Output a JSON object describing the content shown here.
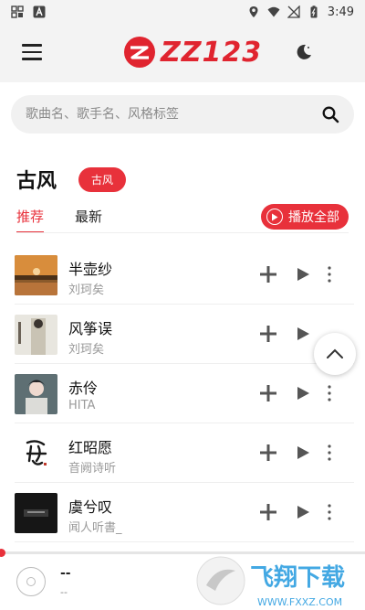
{
  "statusbar": {
    "time": "3:49"
  },
  "app": {
    "logo_text": "ZZ123",
    "brand_color": "#e0242f"
  },
  "search": {
    "placeholder": "歌曲名、歌手名、风格标签"
  },
  "category": {
    "title": "古风",
    "tag": "古风"
  },
  "tabs": [
    {
      "label": "推荐",
      "active": true
    },
    {
      "label": "最新",
      "active": false
    }
  ],
  "play_all_label": "播放全部",
  "songs": [
    {
      "title": "半壶纱",
      "artist": "刘珂矣"
    },
    {
      "title": "风筝误",
      "artist": "刘珂矣"
    },
    {
      "title": "赤伶",
      "artist": "HITA"
    },
    {
      "title": "红昭愿",
      "artist": "音阙诗听"
    },
    {
      "title": "虞兮叹",
      "artist": "闻人听書_"
    }
  ],
  "player": {
    "title": "--",
    "artist": "--",
    "progress": 0
  },
  "watermark": {
    "text": "飞翔下载",
    "url_text": "WWW.FXXZ.COM"
  }
}
